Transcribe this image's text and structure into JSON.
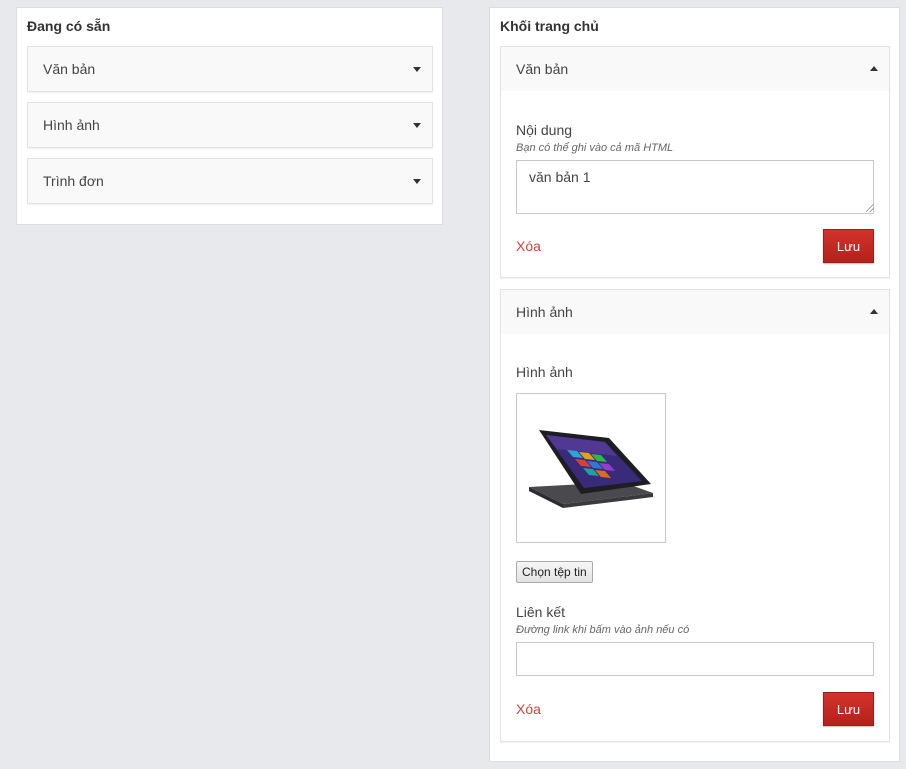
{
  "available": {
    "title": "Đang có sẵn",
    "items": [
      {
        "label": "Văn bản",
        "icon": "caret-down-icon"
      },
      {
        "label": "Hình ảnh",
        "icon": "caret-down-icon"
      },
      {
        "label": "Trình đơn",
        "icon": "caret-down-icon"
      }
    ]
  },
  "home": {
    "title": "Khối trang chủ",
    "text_block": {
      "header": "Văn bản",
      "icon": "caret-up-icon",
      "content_label": "Nội dung",
      "content_help": "Bạn có thể ghi vào cả mã HTML",
      "content_value": "văn bản 1",
      "delete_label": "Xóa",
      "save_label": "Lưu"
    },
    "image_block": {
      "header": "Hình ảnh",
      "icon": "caret-up-icon",
      "image_label": "Hình ảnh",
      "image_alt": "laptop-thumbnail",
      "file_button": "Chọn tệp tin",
      "link_label": "Liên kết",
      "link_help": "Đường link khi bấm vào ảnh nếu có",
      "link_value": "",
      "delete_label": "Xóa",
      "save_label": "Lưu"
    }
  },
  "colors": {
    "page_bg": "#e8e9ec",
    "save_button": "#c4281f",
    "delete_link": "#c9443a"
  }
}
